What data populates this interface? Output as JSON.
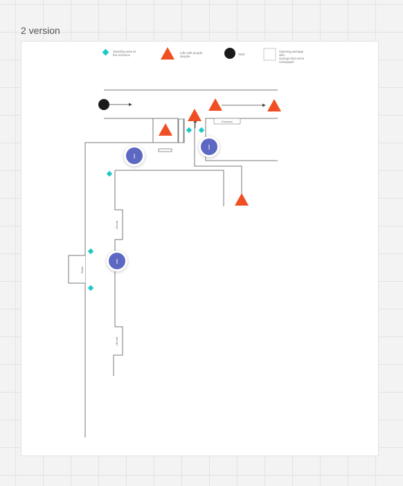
{
  "frame": {
    "title": "2 version"
  },
  "colors": {
    "diamond": "#1fc7c7",
    "triangle": "#f04e23",
    "dot": "#1a1a1a",
    "avatar": "#5b68c2",
    "line": "#777777"
  },
  "legend": [
    {
      "icon": "diamond-icon",
      "text": "Standing area at\nthe entrance"
    },
    {
      "icon": "triangle-icon",
      "text": "Lifts with people\ndespite"
    },
    {
      "icon": "dot-icon",
      "text": "Start"
    },
    {
      "icon": "square-icon",
      "text": "Opening passage with\nsavings that serve\nnewspaper"
    }
  ],
  "labels": {
    "entry_a": "Entrance",
    "corridor_1": "Lift exit",
    "door_left": "Stairs",
    "corridor_2": "Lift exit"
  },
  "avatars": [
    {
      "initial": "I"
    },
    {
      "initial": "I"
    },
    {
      "initial": "I"
    }
  ]
}
